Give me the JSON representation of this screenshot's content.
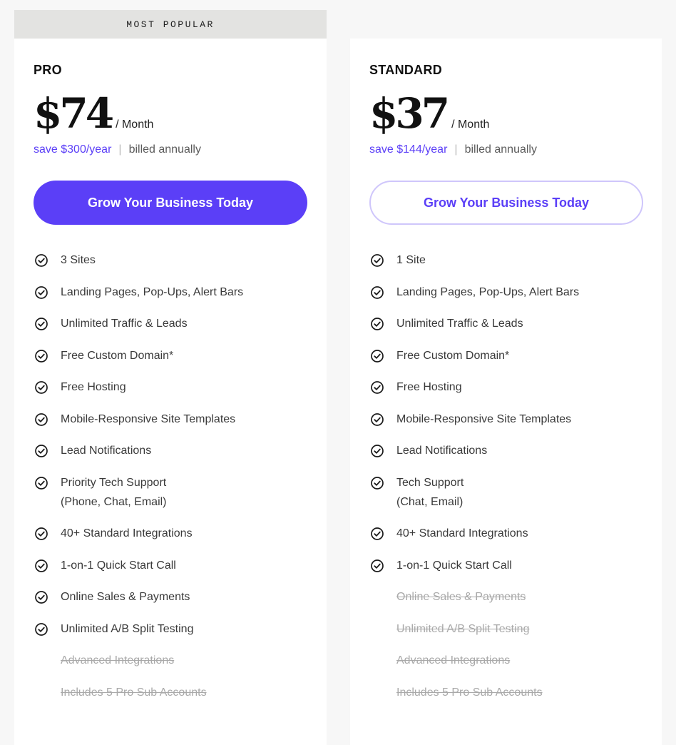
{
  "colors": {
    "accent": "#5b3ff7",
    "accent_light": "#cfc6fb",
    "banner_bg": "#e3e3e1",
    "disabled_text": "#a9a9a9"
  },
  "pro": {
    "banner": "MOST POPULAR",
    "name": "PRO",
    "price": "$74",
    "per": "/ Month",
    "save": "save $300/year",
    "separator": "|",
    "billed": "billed annually",
    "cta": "Grow Your Business Today",
    "features": [
      {
        "label": "3 Sites",
        "sub": "",
        "included": true
      },
      {
        "label": "Landing Pages, Pop-Ups, Alert Bars",
        "sub": "",
        "included": true
      },
      {
        "label": "Unlimited Traffic & Leads",
        "sub": "",
        "included": true
      },
      {
        "label": "Free Custom Domain*",
        "sub": "",
        "included": true
      },
      {
        "label": "Free Hosting",
        "sub": "",
        "included": true
      },
      {
        "label": "Mobile-Responsive Site Templates",
        "sub": "",
        "included": true
      },
      {
        "label": "Lead Notifications",
        "sub": "",
        "included": true
      },
      {
        "label": "Priority Tech Support",
        "sub": "(Phone, Chat, Email)",
        "included": true
      },
      {
        "label": "40+ Standard Integrations",
        "sub": "",
        "included": true
      },
      {
        "label": "1-on-1 Quick Start Call",
        "sub": "",
        "included": true
      },
      {
        "label": "Online Sales & Payments",
        "sub": "",
        "included": true
      },
      {
        "label": "Unlimited A/B Split Testing",
        "sub": "",
        "included": true
      },
      {
        "label": "Advanced Integrations",
        "sub": "",
        "included": false
      },
      {
        "label": "Includes 5 Pro Sub Accounts",
        "sub": "",
        "included": false
      }
    ]
  },
  "standard": {
    "name": "STANDARD",
    "price": "$37",
    "per": "/ Month",
    "save": "save $144/year",
    "separator": "|",
    "billed": "billed annually",
    "cta": "Grow Your Business Today",
    "features": [
      {
        "label": "1 Site",
        "sub": "",
        "included": true
      },
      {
        "label": "Landing Pages, Pop-Ups, Alert Bars",
        "sub": "",
        "included": true
      },
      {
        "label": "Unlimited Traffic & Leads",
        "sub": "",
        "included": true
      },
      {
        "label": "Free Custom Domain*",
        "sub": "",
        "included": true
      },
      {
        "label": "Free Hosting",
        "sub": "",
        "included": true
      },
      {
        "label": "Mobile-Responsive Site Templates",
        "sub": "",
        "included": true
      },
      {
        "label": "Lead Notifications",
        "sub": "",
        "included": true
      },
      {
        "label": "Tech Support",
        "sub": "(Chat, Email)",
        "included": true
      },
      {
        "label": "40+ Standard Integrations",
        "sub": "",
        "included": true
      },
      {
        "label": "1-on-1 Quick Start Call",
        "sub": "",
        "included": true
      },
      {
        "label": "Online Sales & Payments",
        "sub": "",
        "included": false
      },
      {
        "label": "Unlimited A/B Split Testing",
        "sub": "",
        "included": false
      },
      {
        "label": "Advanced Integrations",
        "sub": "",
        "included": false
      },
      {
        "label": "Includes 5 Pro Sub Accounts",
        "sub": "",
        "included": false
      }
    ]
  }
}
